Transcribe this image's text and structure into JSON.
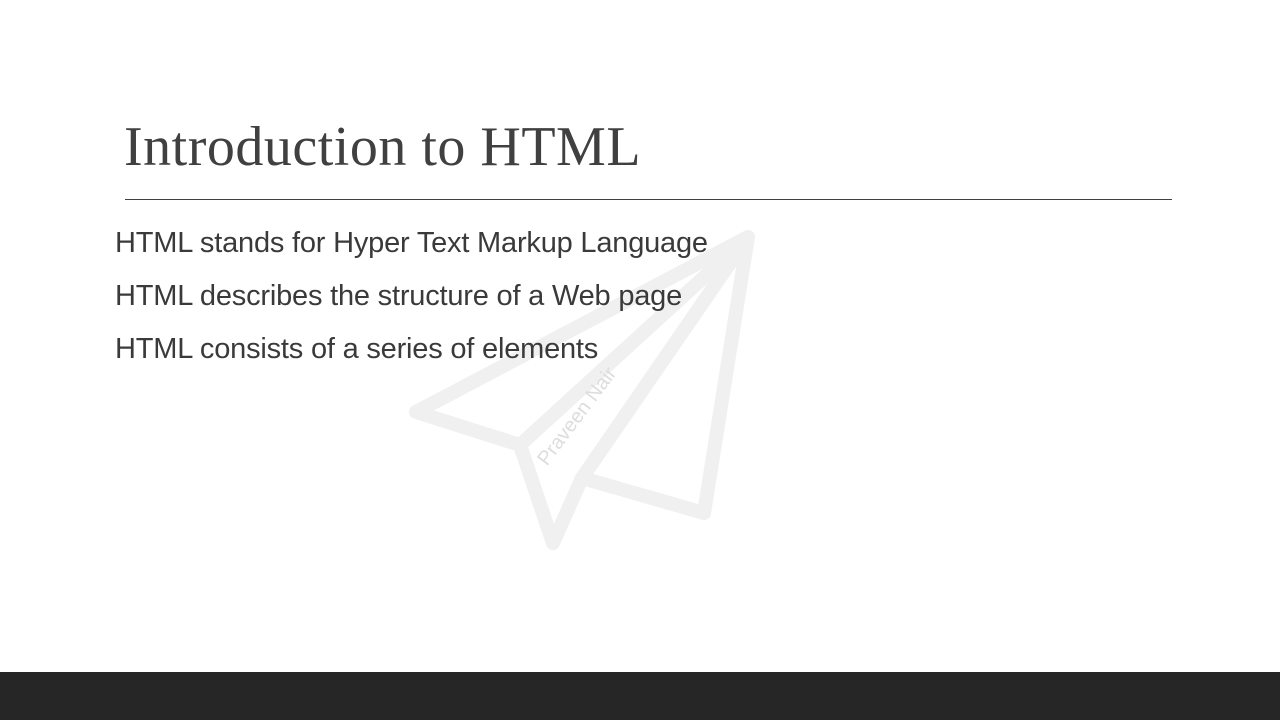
{
  "slide": {
    "title": "Introduction to HTML",
    "bullets": [
      "HTML stands for Hyper Text Markup Language",
      "HTML describes the structure of a Web page",
      "HTML consists of a series of elements"
    ],
    "watermark": {
      "icon": "paper-plane-icon",
      "text": "Praveen Nair",
      "color": "#f0f0f0",
      "text_color": "#dddddd"
    }
  },
  "colors": {
    "text": "#404040",
    "footer": "#262626",
    "background": "#ffffff"
  }
}
